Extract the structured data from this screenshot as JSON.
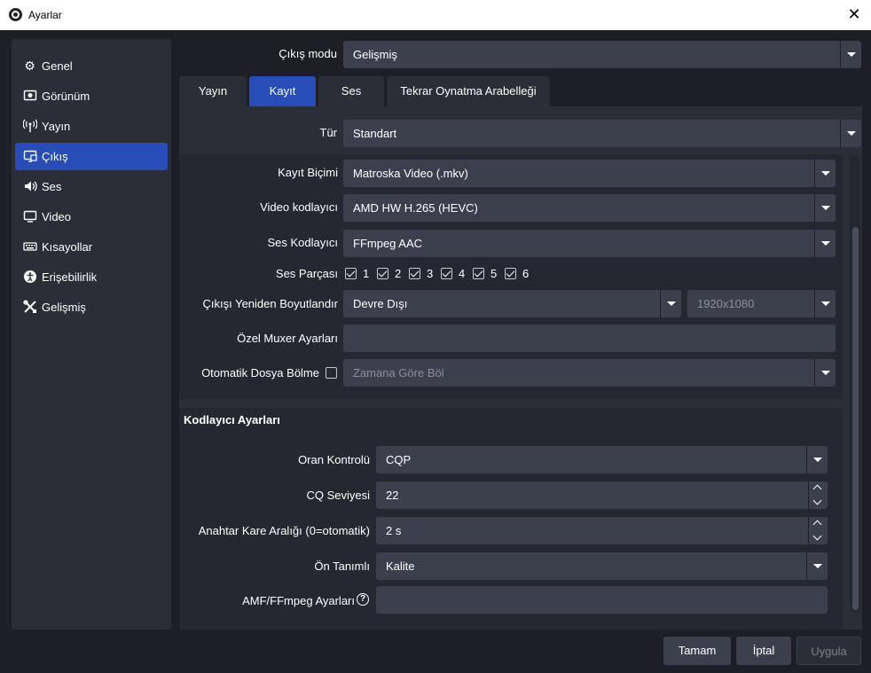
{
  "window": {
    "title": "Ayarlar"
  },
  "sidebar": {
    "items": [
      {
        "label": "Genel",
        "icon": "gear-icon"
      },
      {
        "label": "Görünüm",
        "icon": "appearance-icon"
      },
      {
        "label": "Yayın",
        "icon": "broadcast-icon"
      },
      {
        "label": "Çıkış",
        "icon": "output-icon",
        "active": true
      },
      {
        "label": "Ses",
        "icon": "speaker-icon"
      },
      {
        "label": "Video",
        "icon": "monitor-icon"
      },
      {
        "label": "Kısayollar",
        "icon": "keyboard-icon"
      },
      {
        "label": "Erişebilirlik",
        "icon": "accessibility-icon"
      },
      {
        "label": "Gelişmiş",
        "icon": "tools-icon"
      }
    ]
  },
  "output_mode": {
    "label": "Çıkış modu",
    "value": "Gelişmiş"
  },
  "tabs": [
    {
      "label": "Yayın"
    },
    {
      "label": "Kayıt",
      "active": true
    },
    {
      "label": "Ses"
    },
    {
      "label": "Tekrar Oynatma Arabelleği"
    }
  ],
  "recording": {
    "type": {
      "label": "Tür",
      "value": "Standart"
    },
    "format": {
      "label": "Kayıt Biçimi",
      "value": "Matroska Video (.mkv)"
    },
    "video_encoder": {
      "label": "Video kodlayıcı",
      "value": "AMD HW H.265 (HEVC)"
    },
    "audio_encoder": {
      "label": "Ses Kodlayıcı",
      "value": "FFmpeg AAC"
    },
    "audio_tracks": {
      "label": "Ses Parçası",
      "tracks": [
        "1",
        "2",
        "3",
        "4",
        "5",
        "6"
      ]
    },
    "rescale": {
      "label": "Çıkışı Yeniden Boyutlandır",
      "value": "Devre Dışı",
      "resolution": "1920x1080"
    },
    "muxer": {
      "label": "Özel Muxer Ayarları",
      "value": ""
    },
    "split": {
      "label": "Otomatik Dosya Bölme",
      "value": "Zamana Göre Böl"
    }
  },
  "encoder_settings": {
    "title": "Kodlayıcı Ayarları",
    "rate_control": {
      "label": "Oran Kontrolü",
      "value": "CQP"
    },
    "cq_level": {
      "label": "CQ Seviyesi",
      "value": "22"
    },
    "keyframe": {
      "label": "Anahtar Kare Aralığı (0=otomatik)",
      "value": "2 s"
    },
    "preset": {
      "label": "Ön Tanımlı",
      "value": "Kalite"
    },
    "amf_options": {
      "label": "AMF/FFmpeg Ayarları",
      "value": "",
      "help": "?"
    }
  },
  "buttons": {
    "ok": "Tamam",
    "cancel": "İptal",
    "apply": "Uygula"
  },
  "colors": {
    "accent": "#284cb8",
    "background": "#1e1f26",
    "panel": "#2b2d37",
    "input": "#3c404d"
  }
}
